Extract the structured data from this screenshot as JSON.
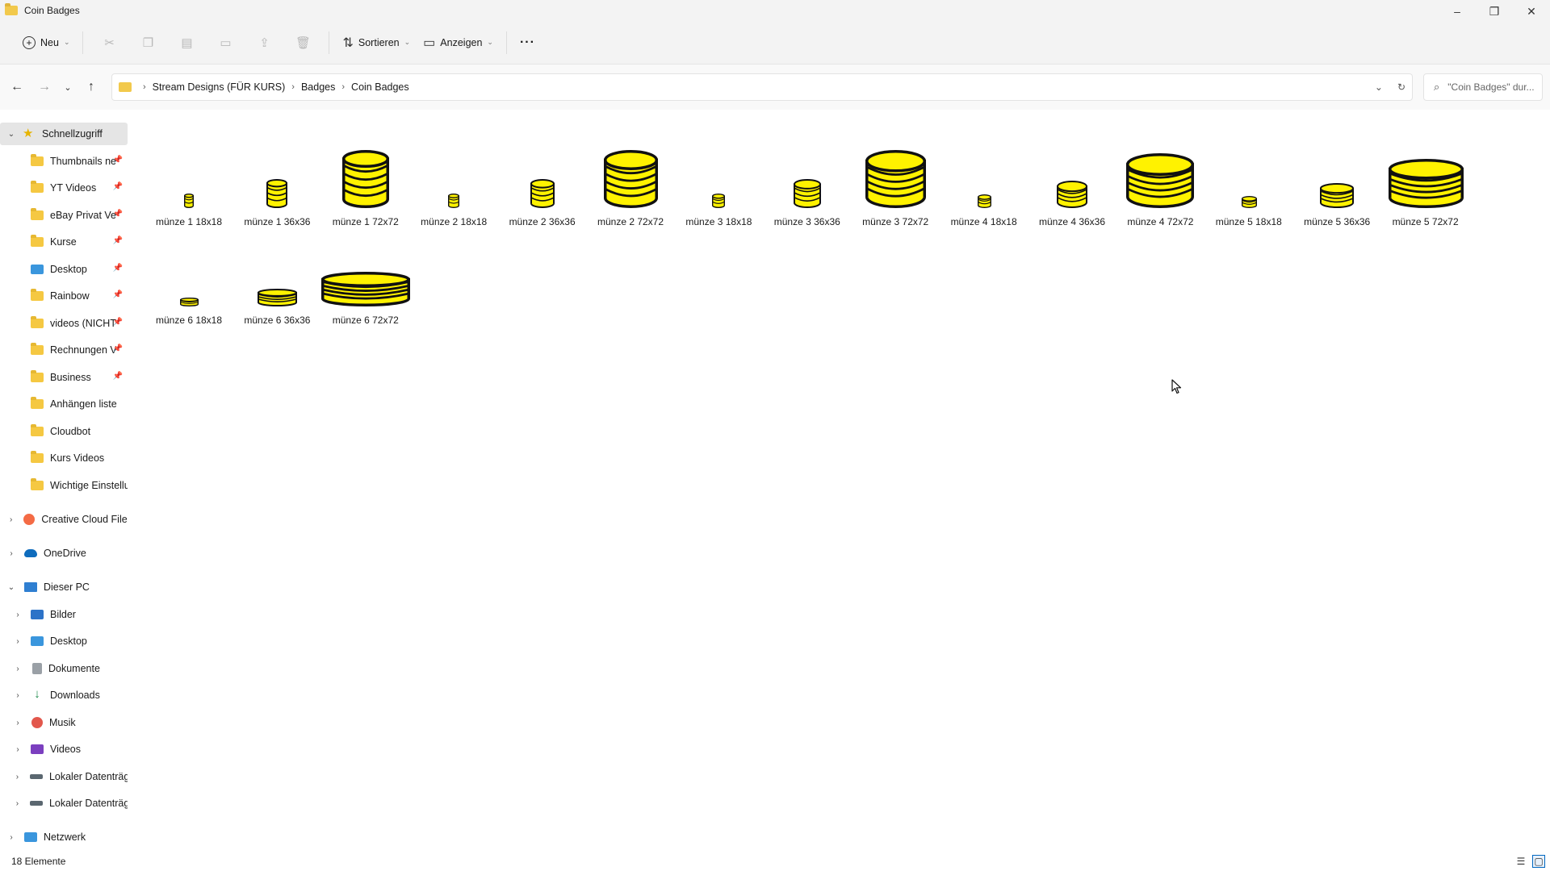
{
  "window": {
    "title": "Coin Badges",
    "controls": {
      "minimize": "–",
      "restore": "❐",
      "close": "✕"
    }
  },
  "toolbar": {
    "new_label": "Neu",
    "sort_label": "Sortieren",
    "view_label": "Anzeigen",
    "more_label": "···"
  },
  "address": {
    "breadcrumbs": [
      "Stream Designs (FÜR KURS)",
      "Badges",
      "Coin Badges"
    ],
    "search_placeholder": "\"Coin Badges\" dur..."
  },
  "sidebar": {
    "quick_access": {
      "label": "Schnellzugriff",
      "items": [
        {
          "label": "Thumbnails neu",
          "icon": "folder-icon",
          "pinned": true
        },
        {
          "label": "YT Videos",
          "icon": "folder-icon",
          "pinned": true
        },
        {
          "label": "eBay Privat Verk",
          "icon": "folder-icon",
          "pinned": true
        },
        {
          "label": "Kurse",
          "icon": "folder-icon",
          "pinned": true
        },
        {
          "label": "Desktop",
          "icon": "desktop-icon",
          "pinned": true
        },
        {
          "label": "Rainbow",
          "icon": "folder-icon",
          "pinned": true
        },
        {
          "label": "videos (NICHT I",
          "icon": "folder-icon",
          "pinned": true
        },
        {
          "label": "Rechnungen Ve",
          "icon": "folder-icon",
          "pinned": true
        },
        {
          "label": "Business",
          "icon": "folder-icon",
          "pinned": true
        },
        {
          "label": "Anhängen liste",
          "icon": "folder-icon",
          "pinned": false
        },
        {
          "label": "Cloudbot",
          "icon": "folder-icon",
          "pinned": false
        },
        {
          "label": "Kurs Videos",
          "icon": "folder-icon",
          "pinned": false
        },
        {
          "label": "Wichtige Einstellur",
          "icon": "folder-icon",
          "pinned": false
        }
      ]
    },
    "creative_cloud": "Creative Cloud Files",
    "onedrive": "OneDrive",
    "this_pc": {
      "label": "Dieser PC",
      "items": [
        {
          "label": "Bilder",
          "icon": "pictures-icon"
        },
        {
          "label": "Desktop",
          "icon": "desktop-icon"
        },
        {
          "label": "Dokumente",
          "icon": "documents-icon"
        },
        {
          "label": "Downloads",
          "icon": "downloads-icon"
        },
        {
          "label": "Musik",
          "icon": "music-icon"
        },
        {
          "label": "Videos",
          "icon": "videos-icon"
        },
        {
          "label": "Lokaler Datenträge",
          "icon": "drive-icon"
        },
        {
          "label": "Lokaler Datenträge",
          "icon": "drive-icon"
        }
      ]
    },
    "network": "Netzwerk"
  },
  "files": [
    {
      "name": "münze 1 18x18"
    },
    {
      "name": "münze 1 36x36"
    },
    {
      "name": "münze 1 72x72"
    },
    {
      "name": "münze 2 18x18"
    },
    {
      "name": "münze 2 36x36"
    },
    {
      "name": "münze 2 72x72"
    },
    {
      "name": "münze 3 18x18"
    },
    {
      "name": "münze 3 36x36"
    },
    {
      "name": "münze 3 72x72"
    },
    {
      "name": "münze 4 18x18"
    },
    {
      "name": "münze 4 36x36"
    },
    {
      "name": "münze 4 72x72"
    },
    {
      "name": "münze 5 18x18"
    },
    {
      "name": "münze 5 36x36"
    },
    {
      "name": "münze 5 72x72"
    },
    {
      "name": "münze 6 18x18"
    },
    {
      "name": "münze 6 36x36"
    },
    {
      "name": "münze 6 72x72"
    }
  ],
  "status": {
    "count_label": "18 Elemente"
  },
  "colors": {
    "coin_fill": "#fff200",
    "coin_stroke": "#111111",
    "selected_bg": "#e5e5e5",
    "accent": "#0067c0"
  }
}
